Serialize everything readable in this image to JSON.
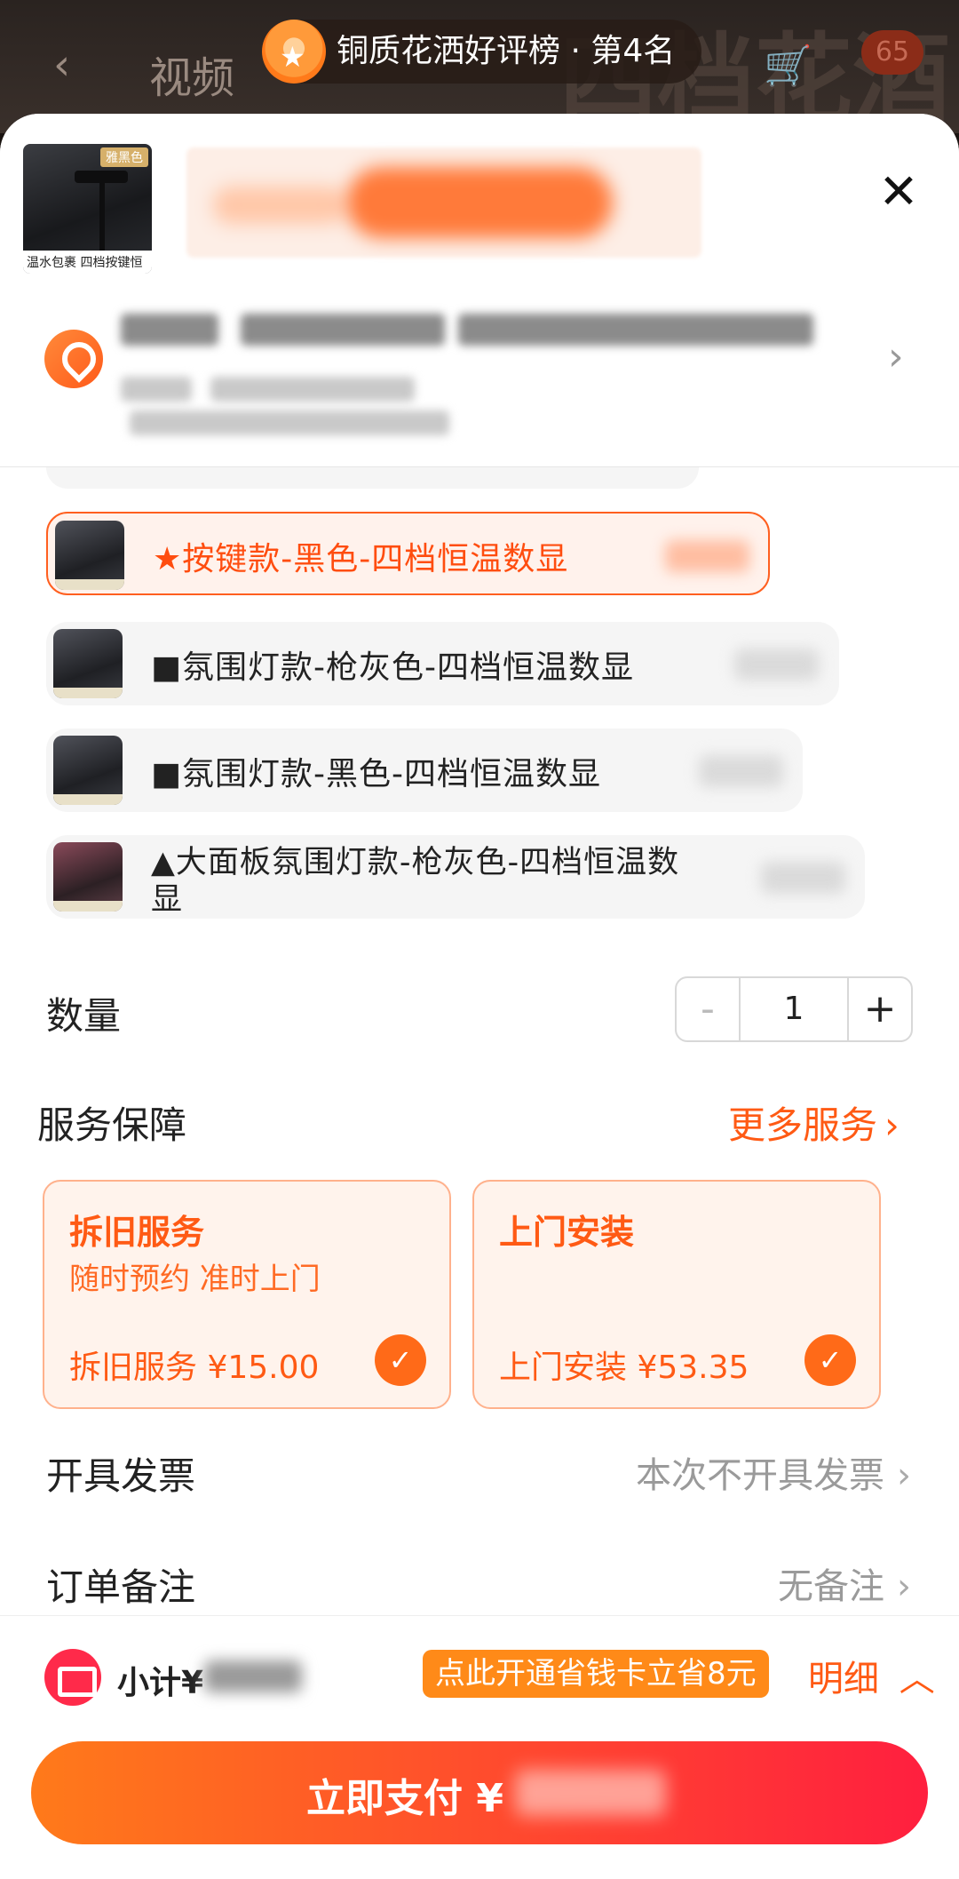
{
  "background": {
    "back_icon": "chevron-left",
    "nav_label": "视频",
    "cart_badge": "65",
    "bg_text": "四档花酒"
  },
  "rank": {
    "text": "铜质花洒好评榜 · 第4名",
    "icon": "medal-icon"
  },
  "header": {
    "product_thumb_tag": "雅黑色",
    "product_thumb_caption": "温水包裹 四档按键恒温数显花洒",
    "close_icon": "close-icon"
  },
  "address": {
    "chevron": "›"
  },
  "options": [
    {
      "label": "★按键款-黑色-四档恒温数显",
      "selected": true
    },
    {
      "label": "■氛围灯款-枪灰色-四档恒温数显",
      "selected": false
    },
    {
      "label": "■氛围灯款-黑色-四档恒温数显",
      "selected": false
    },
    {
      "label": "▲大面板氛围灯款-枪灰色-四档恒温数显",
      "selected": false
    }
  ],
  "quantity": {
    "label": "数量",
    "value": "1",
    "minus": "-",
    "plus": "+"
  },
  "services": {
    "label": "服务保障",
    "more_label": "更多服务",
    "cards": [
      {
        "title": "拆旧服务",
        "subtitle": "随时预约 准时上门",
        "price": "拆旧服务 ¥15.00",
        "checked": true
      },
      {
        "title": "上门安装",
        "subtitle": "",
        "price": "上门安装 ¥53.35",
        "checked": true
      }
    ]
  },
  "invoice": {
    "label": "开具发票",
    "value": "本次不开具发票"
  },
  "remark": {
    "label": "订单备注",
    "value": "无备注"
  },
  "footer": {
    "subtotal_label": "小计¥",
    "promo": "点此开通省钱卡立省8元",
    "detail": "明细",
    "pay_label": "立即支付 ¥"
  },
  "colors": {
    "accent": "#ff5a14",
    "pay_start": "#ff7a1a",
    "pay_end": "#ff1f3f"
  }
}
